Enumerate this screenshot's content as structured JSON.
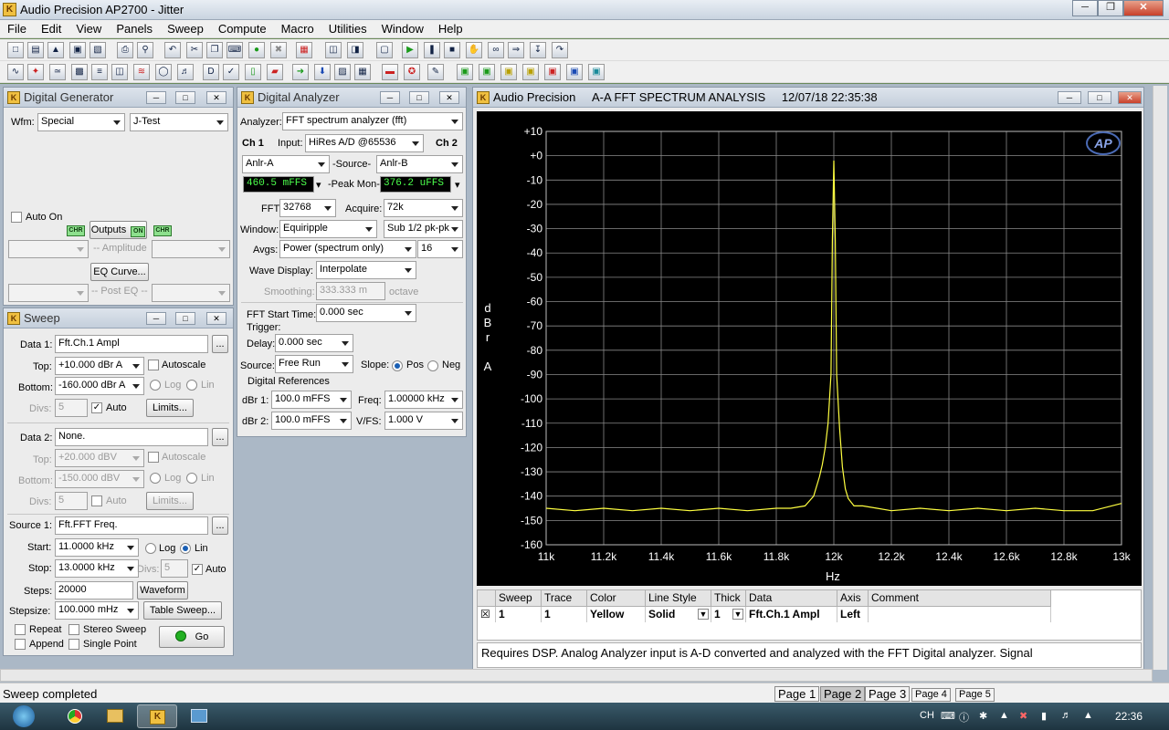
{
  "app": {
    "title": "Audio Precision AP2700 - Jitter",
    "logo_icon": "ap-logo-icon"
  },
  "menu": [
    "File",
    "Edit",
    "View",
    "Panels",
    "Sweep",
    "Compute",
    "Macro",
    "Utilities",
    "Window",
    "Help"
  ],
  "generator": {
    "title": "Digital Generator",
    "wfm_label": "Wfm:",
    "wfm_value": "Special",
    "wfm_sub": "J-Test",
    "auto_on": "Auto On",
    "chr_badge": "CHR",
    "outputs": "Outputs",
    "on_badge": "ON",
    "amplitude": "-- Amplitude",
    "eq_curve": "EQ Curve...",
    "post_eq": "-- Post EQ --"
  },
  "analyzer": {
    "title": "Digital Analyzer",
    "analyzer_label": "Analyzer:",
    "analyzer_value": "FFT spectrum analyzer (fft)",
    "ch1": "Ch 1",
    "input_label": "Input:",
    "input_value": "HiRes A/D @65536",
    "ch2": "Ch 2",
    "src_a": "Anlr-A",
    "source_label": "-Source-",
    "src_b": "Anlr-B",
    "peak_a": "460.5   mFFS",
    "peak_label": "-Peak Mon-",
    "peak_b": "376.2   uFFS",
    "fft_label": "FFT:",
    "fft_value": "32768",
    "acquire_label": "Acquire:",
    "acquire_value": "72k",
    "window_label": "Window:",
    "window_value": "Equiripple",
    "window_sub": "Sub 1/2 pk-pk",
    "avgs_label": "Avgs:",
    "avgs_value": "Power (spectrum only)",
    "avgs_count": "16",
    "wave_label": "Wave Display:",
    "wave_value": "Interpolate",
    "smoothing_label": "Smoothing:",
    "smoothing_value": "333.333 m",
    "octave": "octave",
    "fft_start_label": "FFT Start Time:",
    "fft_start_value": "0.000     sec",
    "trigger": "Trigger:",
    "delay_label": "Delay:",
    "delay_value": "0.000     sec",
    "source2_label": "Source:",
    "source2_value": "Free Run",
    "slope_label": "Slope:",
    "pos": "Pos",
    "neg": "Neg",
    "digital_refs": "Digital References",
    "dbr1_label": "dBr 1:",
    "dbr1_value": "100.0    mFFS",
    "freq_label": "Freq:",
    "freq_value": "1.00000 kHz",
    "dbr2_label": "dBr 2:",
    "dbr2_value": "100.0    mFFS",
    "vfs_label": "V/FS:",
    "vfs_value": "1.000      V"
  },
  "sweep": {
    "title": "Sweep",
    "data1_label": "Data 1:",
    "data1_value": "Fft.Ch.1 Ampl",
    "top_label": "Top:",
    "top_value": "+10.000   dBr A",
    "autoscale": "Autoscale",
    "bottom_label": "Bottom:",
    "bottom_value": "-160.000 dBr A",
    "log": "Log",
    "lin": "Lin",
    "divs_label": "Divs:",
    "divs_value": "5",
    "auto": "Auto",
    "limits": "Limits...",
    "data2_label": "Data 2:",
    "data2_value": "None.",
    "top2_value": "+20.000   dBV",
    "bottom2_value": "-150.000 dBV",
    "divs2_value": "5",
    "source1_label": "Source 1:",
    "source1_value": "Fft.FFT Freq.",
    "start_label": "Start:",
    "start_value": "11.0000 kHz",
    "stop_label": "Stop:",
    "stop_value": "13.0000 kHz",
    "divs3_value": "5",
    "steps_label": "Steps:",
    "steps_value": "20000",
    "waveform": "Waveform",
    "stepsize_label": "Stepsize:",
    "stepsize_value": "100.000 mHz",
    "table_sweep": "Table Sweep...",
    "repeat": "Repeat",
    "stereo": "Stereo Sweep",
    "append": "Append",
    "single": "Single Point",
    "go": "Go"
  },
  "graph": {
    "title": "Audio Precision",
    "subtitle": "A-A FFT SPECTRUM ANALYSIS",
    "datetime": "12/07/18 22:35:38",
    "ap_badge": "AP",
    "grid_headers": [
      "Sweep",
      "Trace",
      "Color",
      "Line Style",
      "Thick",
      "Data",
      "Axis",
      "Comment"
    ],
    "grid_row": [
      "1",
      "1",
      "Yellow",
      "Solid",
      "1",
      "Fft.Ch.1 Ampl",
      "Left",
      ""
    ],
    "comment": "Requires DSP.  Analog Analyzer input is A-D converted and analyzed with the FFT Digital analyzer.  Signal"
  },
  "chart_data": {
    "type": "line",
    "xlabel": "Hz",
    "ylabel": "dBr A",
    "xlim": [
      11000,
      13000
    ],
    "ylim": [
      -160,
      10
    ],
    "x_ticks": [
      "11k",
      "11.2k",
      "11.4k",
      "11.6k",
      "11.8k",
      "12k",
      "12.2k",
      "12.4k",
      "12.6k",
      "12.8k",
      "13k"
    ],
    "y_ticks": [
      "+10",
      "+0",
      "-10",
      "-20",
      "-30",
      "-40",
      "-50",
      "-60",
      "-70",
      "-80",
      "-90",
      "-100",
      "-110",
      "-120",
      "-130",
      "-140",
      "-150",
      "-160"
    ],
    "grid": true,
    "line_color": "#ffff40",
    "series": [
      {
        "x": [
          11000,
          11100,
          11200,
          11300,
          11400,
          11500,
          11600,
          11700,
          11800,
          11850,
          11900,
          11930,
          11950,
          11960,
          11970,
          11980,
          11990,
          11995,
          12000,
          12005,
          12010,
          12020,
          12030,
          12040,
          12050,
          12070,
          12100,
          12150,
          12200,
          12300,
          12400,
          12500,
          12600,
          12700,
          12800,
          12900,
          13000
        ],
        "y": [
          -145,
          -146,
          -145,
          -146,
          -145,
          -146,
          -145,
          -146,
          -145,
          -145,
          -144,
          -140,
          -132,
          -127,
          -120,
          -110,
          -90,
          -35,
          -2,
          -35,
          -90,
          -112,
          -128,
          -137,
          -141,
          -144,
          -144,
          -145,
          -146,
          -145,
          -146,
          -145,
          -146,
          -145,
          -146,
          -146,
          -143
        ]
      }
    ]
  },
  "status": {
    "text": "Sweep completed",
    "pages": [
      "Page 1",
      "Page 2",
      "Page 3",
      "Page 4",
      "Page 5"
    ]
  },
  "taskbar": {
    "lang": "CH",
    "clock": "22:36"
  }
}
